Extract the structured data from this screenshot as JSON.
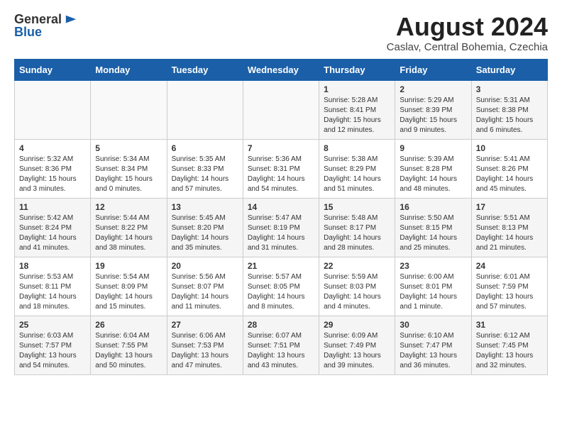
{
  "header": {
    "logo_general": "General",
    "logo_blue": "Blue",
    "month_year": "August 2024",
    "location": "Caslav, Central Bohemia, Czechia"
  },
  "days_of_week": [
    "Sunday",
    "Monday",
    "Tuesday",
    "Wednesday",
    "Thursday",
    "Friday",
    "Saturday"
  ],
  "weeks": [
    [
      {
        "day": "",
        "info": ""
      },
      {
        "day": "",
        "info": ""
      },
      {
        "day": "",
        "info": ""
      },
      {
        "day": "",
        "info": ""
      },
      {
        "day": "1",
        "info": "Sunrise: 5:28 AM\nSunset: 8:41 PM\nDaylight: 15 hours\nand 12 minutes."
      },
      {
        "day": "2",
        "info": "Sunrise: 5:29 AM\nSunset: 8:39 PM\nDaylight: 15 hours\nand 9 minutes."
      },
      {
        "day": "3",
        "info": "Sunrise: 5:31 AM\nSunset: 8:38 PM\nDaylight: 15 hours\nand 6 minutes."
      }
    ],
    [
      {
        "day": "4",
        "info": "Sunrise: 5:32 AM\nSunset: 8:36 PM\nDaylight: 15 hours\nand 3 minutes."
      },
      {
        "day": "5",
        "info": "Sunrise: 5:34 AM\nSunset: 8:34 PM\nDaylight: 15 hours\nand 0 minutes."
      },
      {
        "day": "6",
        "info": "Sunrise: 5:35 AM\nSunset: 8:33 PM\nDaylight: 14 hours\nand 57 minutes."
      },
      {
        "day": "7",
        "info": "Sunrise: 5:36 AM\nSunset: 8:31 PM\nDaylight: 14 hours\nand 54 minutes."
      },
      {
        "day": "8",
        "info": "Sunrise: 5:38 AM\nSunset: 8:29 PM\nDaylight: 14 hours\nand 51 minutes."
      },
      {
        "day": "9",
        "info": "Sunrise: 5:39 AM\nSunset: 8:28 PM\nDaylight: 14 hours\nand 48 minutes."
      },
      {
        "day": "10",
        "info": "Sunrise: 5:41 AM\nSunset: 8:26 PM\nDaylight: 14 hours\nand 45 minutes."
      }
    ],
    [
      {
        "day": "11",
        "info": "Sunrise: 5:42 AM\nSunset: 8:24 PM\nDaylight: 14 hours\nand 41 minutes."
      },
      {
        "day": "12",
        "info": "Sunrise: 5:44 AM\nSunset: 8:22 PM\nDaylight: 14 hours\nand 38 minutes."
      },
      {
        "day": "13",
        "info": "Sunrise: 5:45 AM\nSunset: 8:20 PM\nDaylight: 14 hours\nand 35 minutes."
      },
      {
        "day": "14",
        "info": "Sunrise: 5:47 AM\nSunset: 8:19 PM\nDaylight: 14 hours\nand 31 minutes."
      },
      {
        "day": "15",
        "info": "Sunrise: 5:48 AM\nSunset: 8:17 PM\nDaylight: 14 hours\nand 28 minutes."
      },
      {
        "day": "16",
        "info": "Sunrise: 5:50 AM\nSunset: 8:15 PM\nDaylight: 14 hours\nand 25 minutes."
      },
      {
        "day": "17",
        "info": "Sunrise: 5:51 AM\nSunset: 8:13 PM\nDaylight: 14 hours\nand 21 minutes."
      }
    ],
    [
      {
        "day": "18",
        "info": "Sunrise: 5:53 AM\nSunset: 8:11 PM\nDaylight: 14 hours\nand 18 minutes."
      },
      {
        "day": "19",
        "info": "Sunrise: 5:54 AM\nSunset: 8:09 PM\nDaylight: 14 hours\nand 15 minutes."
      },
      {
        "day": "20",
        "info": "Sunrise: 5:56 AM\nSunset: 8:07 PM\nDaylight: 14 hours\nand 11 minutes."
      },
      {
        "day": "21",
        "info": "Sunrise: 5:57 AM\nSunset: 8:05 PM\nDaylight: 14 hours\nand 8 minutes."
      },
      {
        "day": "22",
        "info": "Sunrise: 5:59 AM\nSunset: 8:03 PM\nDaylight: 14 hours\nand 4 minutes."
      },
      {
        "day": "23",
        "info": "Sunrise: 6:00 AM\nSunset: 8:01 PM\nDaylight: 14 hours\nand 1 minute."
      },
      {
        "day": "24",
        "info": "Sunrise: 6:01 AM\nSunset: 7:59 PM\nDaylight: 13 hours\nand 57 minutes."
      }
    ],
    [
      {
        "day": "25",
        "info": "Sunrise: 6:03 AM\nSunset: 7:57 PM\nDaylight: 13 hours\nand 54 minutes."
      },
      {
        "day": "26",
        "info": "Sunrise: 6:04 AM\nSunset: 7:55 PM\nDaylight: 13 hours\nand 50 minutes."
      },
      {
        "day": "27",
        "info": "Sunrise: 6:06 AM\nSunset: 7:53 PM\nDaylight: 13 hours\nand 47 minutes."
      },
      {
        "day": "28",
        "info": "Sunrise: 6:07 AM\nSunset: 7:51 PM\nDaylight: 13 hours\nand 43 minutes."
      },
      {
        "day": "29",
        "info": "Sunrise: 6:09 AM\nSunset: 7:49 PM\nDaylight: 13 hours\nand 39 minutes."
      },
      {
        "day": "30",
        "info": "Sunrise: 6:10 AM\nSunset: 7:47 PM\nDaylight: 13 hours\nand 36 minutes."
      },
      {
        "day": "31",
        "info": "Sunrise: 6:12 AM\nSunset: 7:45 PM\nDaylight: 13 hours\nand 32 minutes."
      }
    ]
  ]
}
